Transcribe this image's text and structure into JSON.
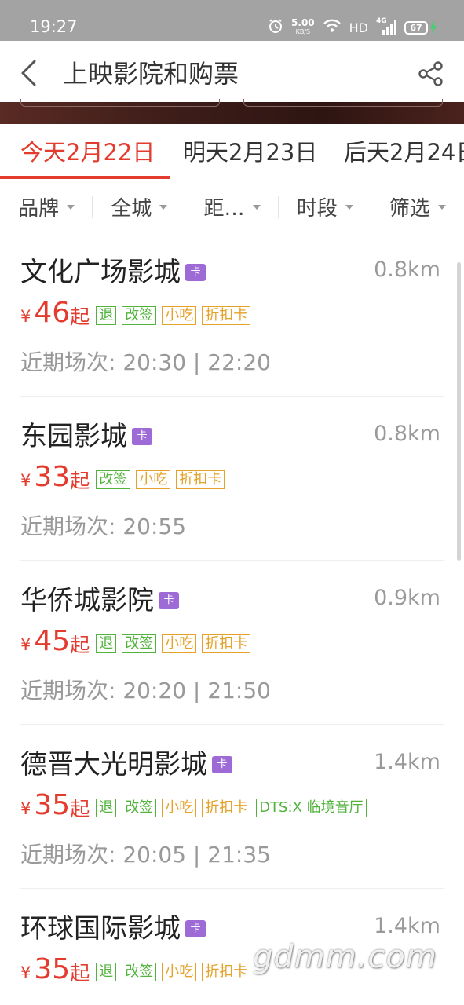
{
  "status_bar": {
    "time": "19:27",
    "net_speed": "5.00",
    "net_unit": "KB/S",
    "hd": "HD",
    "network": "4G",
    "battery": "67"
  },
  "header": {
    "title": "上映影院和购票"
  },
  "date_tabs": [
    {
      "label": "今天2月22日",
      "active": true
    },
    {
      "label": "明天2月23日",
      "active": false
    },
    {
      "label": "后天2月24日",
      "active": false
    }
  ],
  "filters": [
    "品牌",
    "全城",
    "距…",
    "时段",
    "筛选"
  ],
  "card_badge": "卡",
  "currency": "¥",
  "price_suffix": "起",
  "cinemas": [
    {
      "name": "文化广场影城",
      "distance": "0.8km",
      "price": "46",
      "tags": [
        {
          "label": "退",
          "color": "green"
        },
        {
          "label": "改签",
          "color": "green"
        },
        {
          "label": "小吃",
          "color": "orange"
        },
        {
          "label": "折扣卡",
          "color": "orange"
        }
      ],
      "showtimes": "近期场次: 20:30 | 22:20"
    },
    {
      "name": "东园影城",
      "distance": "0.8km",
      "price": "33",
      "tags": [
        {
          "label": "改签",
          "color": "green"
        },
        {
          "label": "小吃",
          "color": "orange"
        },
        {
          "label": "折扣卡",
          "color": "orange"
        }
      ],
      "showtimes": "近期场次: 20:55"
    },
    {
      "name": "华侨城影院",
      "distance": "0.9km",
      "price": "45",
      "tags": [
        {
          "label": "退",
          "color": "green"
        },
        {
          "label": "改签",
          "color": "green"
        },
        {
          "label": "小吃",
          "color": "orange"
        },
        {
          "label": "折扣卡",
          "color": "orange"
        }
      ],
      "showtimes": "近期场次: 20:20 | 21:50"
    },
    {
      "name": "德晋大光明影城",
      "distance": "1.4km",
      "price": "35",
      "tags": [
        {
          "label": "退",
          "color": "green"
        },
        {
          "label": "改签",
          "color": "green"
        },
        {
          "label": "小吃",
          "color": "orange"
        },
        {
          "label": "折扣卡",
          "color": "orange"
        },
        {
          "label": "DTS:X 临境音厅",
          "color": "green"
        }
      ],
      "showtimes": "近期场次: 20:05 | 21:35"
    },
    {
      "name": "环球国际影城",
      "distance": "1.4km",
      "price": "35",
      "tags": [
        {
          "label": "退",
          "color": "green"
        },
        {
          "label": "改签",
          "color": "green"
        },
        {
          "label": "小吃",
          "color": "orange"
        },
        {
          "label": "折扣卡",
          "color": "orange"
        }
      ],
      "showtimes": ""
    }
  ],
  "watermark": "gdmm.com",
  "colors": {
    "accent": "#e33c2e",
    "tag_green": "#52b33c",
    "tag_orange": "#e5a22b",
    "card_badge": "#9e6ad6"
  }
}
